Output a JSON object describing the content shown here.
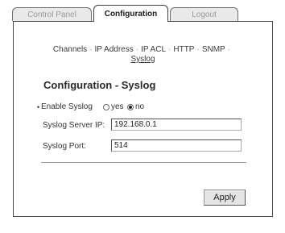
{
  "tabs": [
    {
      "label": "Control Panel",
      "active": false
    },
    {
      "label": "Configuration",
      "active": true
    },
    {
      "label": "Logout",
      "active": false
    }
  ],
  "nav": {
    "items": [
      "Channels",
      "IP Address",
      "IP ACL",
      "HTTP",
      "SNMP",
      "Syslog"
    ],
    "active": "Syslog",
    "separator": "·"
  },
  "form": {
    "title": "Configuration - Syslog",
    "enable_label": "Enable Syslog",
    "enable_options": [
      {
        "label": "yes",
        "checked": false
      },
      {
        "label": "no",
        "checked": true
      }
    ],
    "server_ip_label": "Syslog Server IP:",
    "server_ip_value": "192.168.0.1",
    "port_label": "Syslog Port:",
    "port_value": "514",
    "apply_label": "Apply"
  },
  "colors": {
    "border": "#4a4a4a",
    "inactive_tab_text": "#9a9a9a",
    "button_bg": "#e4e4e4"
  }
}
